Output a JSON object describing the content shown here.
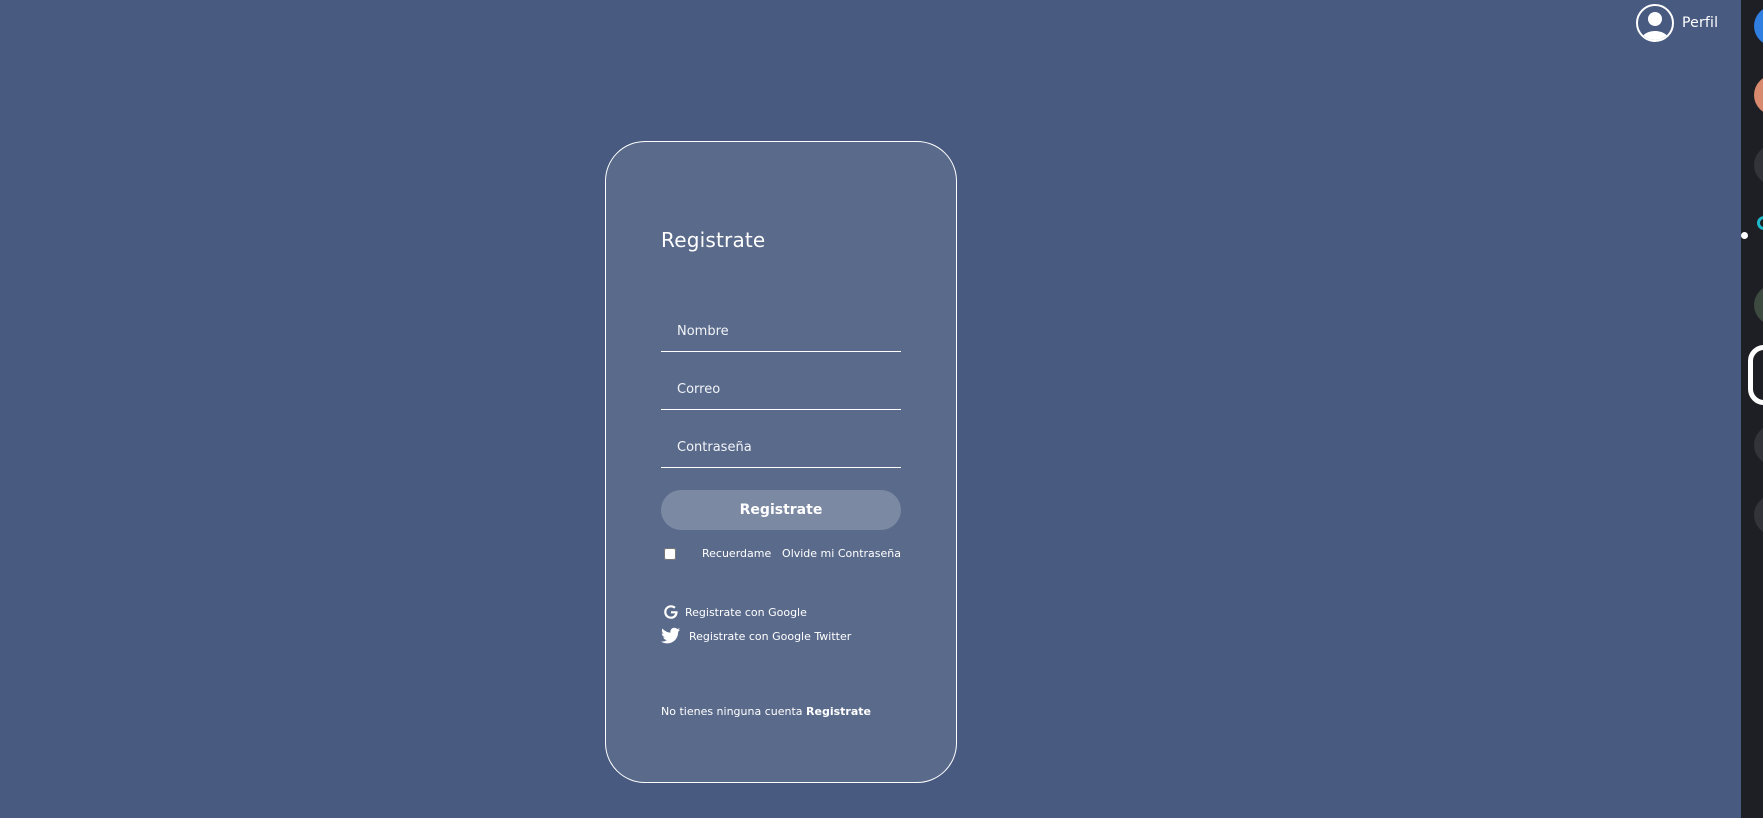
{
  "profile": {
    "label": "Perfil",
    "icon": "user-avatar-icon"
  },
  "form": {
    "title": "Registrate",
    "fields": {
      "name_placeholder": "Nombre",
      "email_placeholder": "Correo",
      "password_placeholder": "Contraseña"
    },
    "submit_label": "Registrate",
    "remember_label": "Recuerdame",
    "forgot_label": "Olvide mi Contraseña",
    "social": {
      "google_label": "Registrate con Google",
      "twitter_label": "Registrate con Google Twitter"
    },
    "footer": {
      "prompt": "No tienes ninguna cuenta",
      "link_label": "Registrate"
    }
  },
  "colors": {
    "background": "#485a80",
    "card": "#5a6a8b",
    "button": "#7b89a3",
    "text": "#ffffff"
  }
}
